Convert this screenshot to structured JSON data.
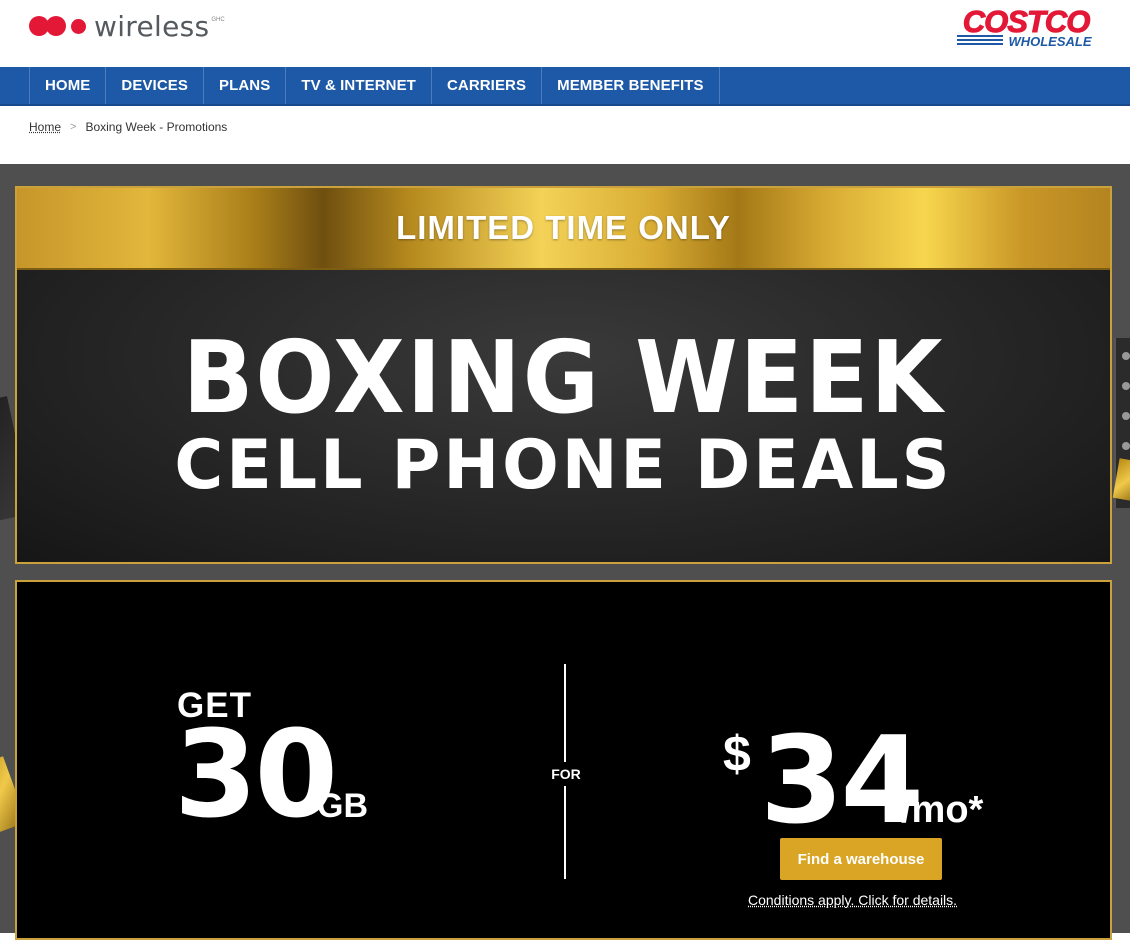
{
  "header": {
    "brand_wireless": "wireless",
    "brand_wireless_sup": "GHC",
    "brand_costco_top": "COSTCO",
    "brand_costco_bottom": "WHOLESALE"
  },
  "nav": {
    "items": [
      {
        "label": "HOME"
      },
      {
        "label": "DEVICES"
      },
      {
        "label": "PLANS"
      },
      {
        "label": "TV & INTERNET"
      },
      {
        "label": "CARRIERS"
      },
      {
        "label": "MEMBER BENEFITS"
      }
    ]
  },
  "breadcrumb": {
    "home": "Home",
    "separator": ">",
    "current": "Boxing Week - Promotions"
  },
  "banner": {
    "ribbon": "LIMITED TIME ONLY",
    "headline": "BOXING WEEK",
    "subheadline": "CELL PHONE DEALS"
  },
  "offer": {
    "get": "GET",
    "data_amount": "30",
    "data_unit": "GB",
    "for": "FOR",
    "currency": "$",
    "price": "34",
    "price_period": "/mo*",
    "cta": "Find a warehouse",
    "conditions": "Conditions apply. Click for details."
  },
  "colors": {
    "nav_blue": "#1d59a6",
    "costco_red": "#e31837",
    "costco_blue": "#1d59a6",
    "gold": "#daa524",
    "banner_dark": "#262626"
  }
}
